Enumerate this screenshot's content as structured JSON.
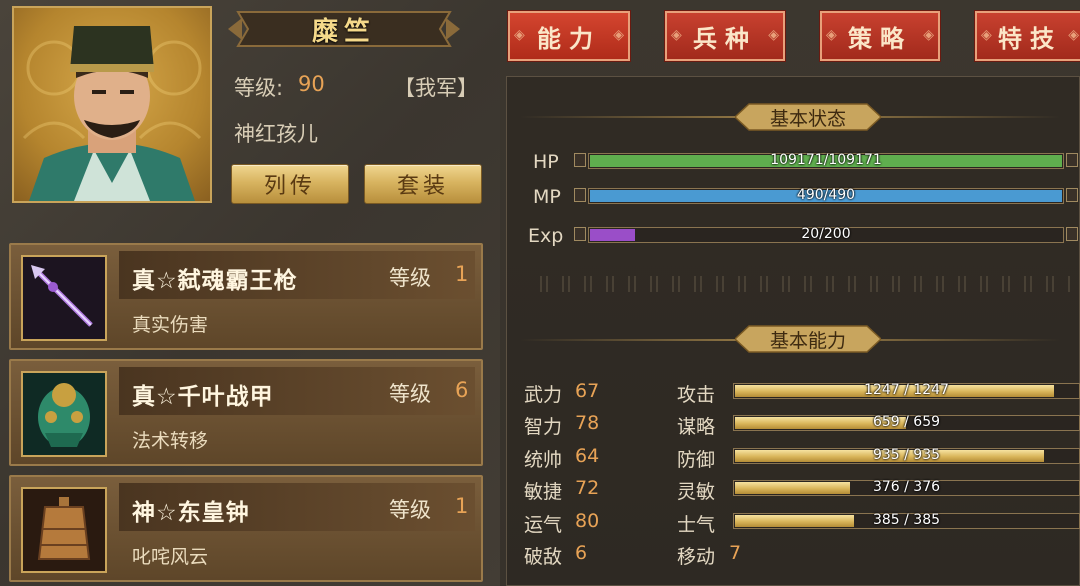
{
  "hero": {
    "name": "糜竺",
    "level_label": "等级:",
    "level": "90",
    "faction": "【我军】",
    "title": "神红孩儿"
  },
  "buttons": {
    "biography": "列传",
    "set": "套装"
  },
  "tabs": [
    {
      "label": "能力",
      "active": true
    },
    {
      "label": "兵种",
      "active": false
    },
    {
      "label": "策略",
      "active": false
    },
    {
      "label": "特技",
      "active": false
    }
  ],
  "basic_status": {
    "header": "基本状态",
    "hp": {
      "label": "HP",
      "text": "109171/109171",
      "fraction": 1.0,
      "color": "#5fae4e"
    },
    "mp": {
      "label": "MP",
      "text": "490/490",
      "fraction": 1.0,
      "color": "#4a9ad2"
    },
    "exp": {
      "label": "Exp",
      "text": "20/200",
      "fraction": 0.1,
      "color": "#9a4ec8"
    }
  },
  "basic_ability": {
    "header": "基本能力",
    "attributes": [
      {
        "name": "武力",
        "value": "67"
      },
      {
        "name": "智力",
        "value": "78"
      },
      {
        "name": "统帅",
        "value": "64"
      },
      {
        "name": "敏捷",
        "value": "72"
      },
      {
        "name": "运气",
        "value": "80"
      },
      {
        "name": "破敌",
        "value": "6"
      }
    ],
    "combat": [
      {
        "name": "攻击",
        "text": "1247 / 1247",
        "fraction": 0.93
      },
      {
        "name": "谋略",
        "text": "659 / 659",
        "fraction": 0.5
      },
      {
        "name": "防御",
        "text": "935 / 935",
        "fraction": 0.9
      },
      {
        "name": "灵敏",
        "text": "376 / 376",
        "fraction": 0.34
      },
      {
        "name": "士气",
        "text": "385 / 385",
        "fraction": 0.35
      }
    ],
    "move": {
      "name": "移动",
      "value": "7"
    }
  },
  "equipment": [
    {
      "name": "真☆弑魂霸王枪",
      "level_label": "等级",
      "level": "1",
      "desc": "真实伤害",
      "icon": "spear-icon"
    },
    {
      "name": "真☆千叶战甲",
      "level_label": "等级",
      "level": "6",
      "desc": "法术转移",
      "icon": "armor-icon"
    },
    {
      "name": "神☆东皇钟",
      "level_label": "等级",
      "level": "1",
      "desc": "叱咤风云",
      "icon": "bell-icon"
    }
  ]
}
